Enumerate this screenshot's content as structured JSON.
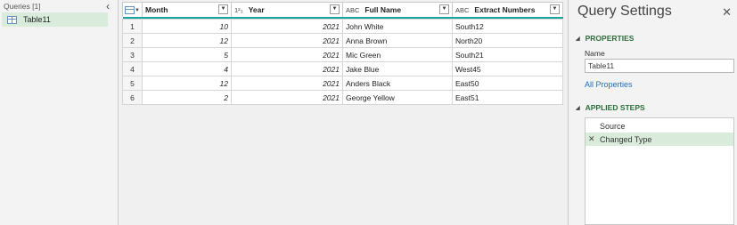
{
  "queries_pane": {
    "header": "Queries [1]",
    "collapse_icon": "chevron-left-icon",
    "items": [
      {
        "label": "Table11",
        "icon": "table-icon"
      }
    ]
  },
  "grid": {
    "columns": [
      {
        "label": "Month",
        "type_icon": "",
        "type_name": "whole-number"
      },
      {
        "label": "Year",
        "type_icon": "1²₃",
        "type_name": "whole-number"
      },
      {
        "label": "Full Name",
        "type_icon": "ABC",
        "type_name": "text"
      },
      {
        "label": "Extract Numbers",
        "type_icon": "ABC",
        "type_name": "text"
      }
    ],
    "accent_color": "#1ba39c",
    "rows": [
      {
        "n": "1",
        "month": "10",
        "year": "2021",
        "name": "John White",
        "extract": "South12"
      },
      {
        "n": "2",
        "month": "12",
        "year": "2021",
        "name": "Anna Brown",
        "extract": "North20"
      },
      {
        "n": "3",
        "month": "5",
        "year": "2021",
        "name": "Mic Green",
        "extract": "South21"
      },
      {
        "n": "4",
        "month": "4",
        "year": "2021",
        "name": "Jake Blue",
        "extract": "West45"
      },
      {
        "n": "5",
        "month": "12",
        "year": "2021",
        "name": "Anders Black",
        "extract": "East50"
      },
      {
        "n": "6",
        "month": "2",
        "year": "2021",
        "name": "George Yellow",
        "extract": "East51"
      }
    ]
  },
  "settings": {
    "title": "Query Settings",
    "close_icon": "close-icon",
    "properties_heading": "PROPERTIES",
    "name_label": "Name",
    "name_value": "Table11",
    "all_properties_link": "All Properties",
    "applied_steps_heading": "APPLIED STEPS",
    "steps": [
      {
        "label": "Source",
        "active": false
      },
      {
        "label": "Changed Type",
        "active": true
      }
    ],
    "active_step_color": "#d9ecdc",
    "heading_color": "#2a6e3a"
  }
}
